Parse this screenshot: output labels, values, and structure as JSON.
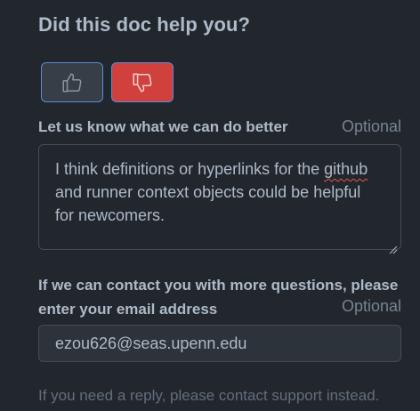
{
  "feedback": {
    "title": "Did this doc help you?",
    "thumbs_up_icon": "thumbs-up-icon",
    "thumbs_down_icon": "thumbs-down-icon",
    "thumbs_down_selected": true,
    "comment_label": "Let us know what we can do better",
    "comment_optional": "Optional",
    "comment_line_1_before": "I think definitions or hyperlinks for the ",
    "comment_line_1_misspelled": "github",
    "comment_line_2": "and runner context objects could be helpful",
    "comment_line_3": "for newcomers.",
    "email_label": "If we can contact you with more questions, please enter your email address",
    "email_optional": "Optional",
    "email_value": "ezou626@seas.upenn.edu",
    "help_text": "If you need a reply, please contact support instead."
  },
  "colors": {
    "background": "#22272e",
    "thumbs_down_active": "#d0413d",
    "focus_border": "#5a8bd6",
    "spellcheck_underline": "#e5534b"
  }
}
